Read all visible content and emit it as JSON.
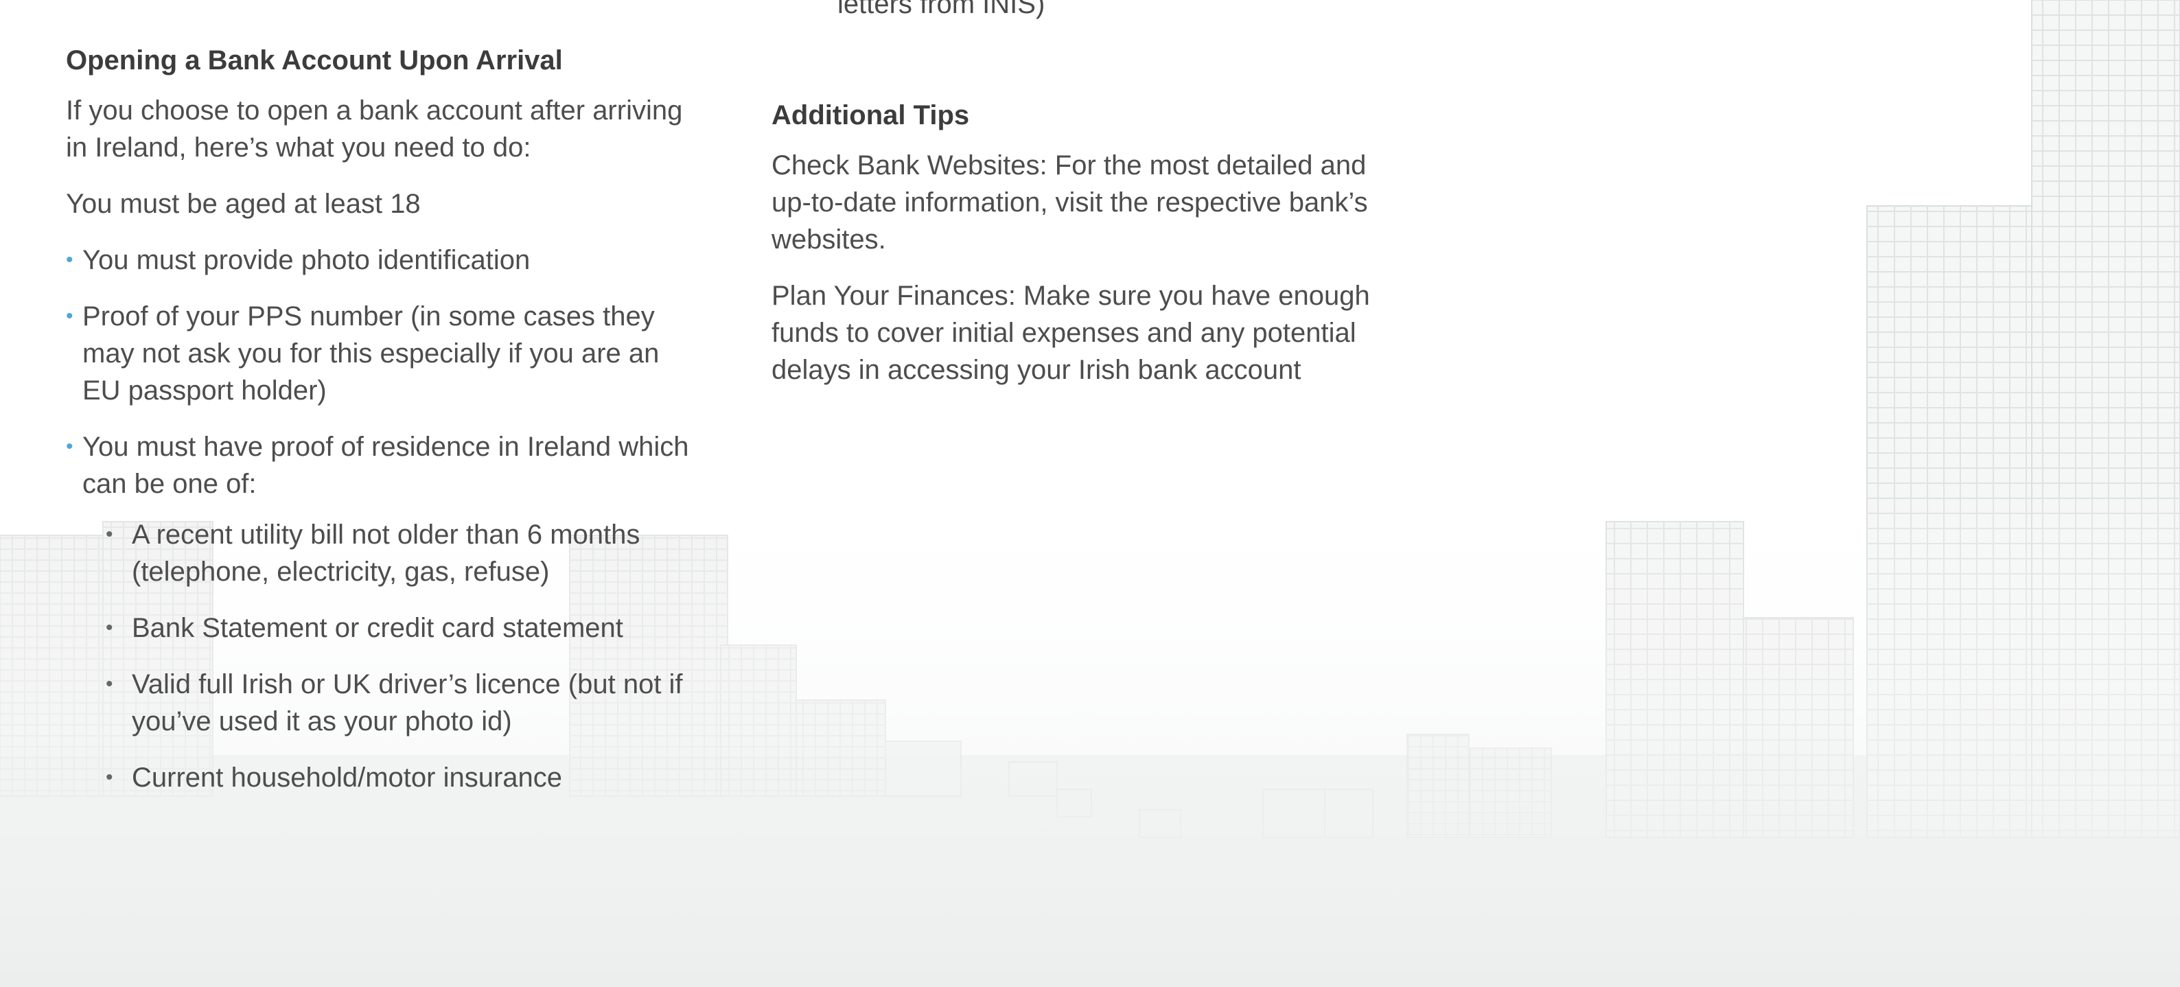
{
  "top_fragment": "letters from INIS)",
  "left_column": {
    "heading": "Opening a Bank Account Upon Arrival",
    "intro": "If you choose to open a bank account after arriving in Ireland, here’s what you need to do:",
    "age_requirement": "You must be aged at least 18",
    "requirements": [
      "You must provide photo identification",
      "Proof of your PPS number (in some cases they may not ask you for this especially if you are an EU passport holder)",
      "You must have proof of residence in Ireland which can be one of:"
    ],
    "residence_proofs": [
      "A recent utility bill not older than 6 months (telephone, electricity, gas, refuse)",
      "Bank Statement or credit card statement",
      "Valid full Irish or UK driver’s licence (but not if you’ve used it as your photo id)",
      "Current household/motor insurance"
    ]
  },
  "right_column": {
    "heading": "Additional Tips",
    "tips": [
      "Check Bank Websites: For the most detailed and up-to-date information, visit the respective bank’s websites.",
      "Plan Your Finances: Make sure you have enough funds to cover initial expenses and any potential delays in accessing your Irish bank account"
    ]
  },
  "colors": {
    "bullet_accent": "#4fa7d8",
    "body_text": "#4d4d4d",
    "skyline": "#d9dcdc"
  },
  "icons": {
    "background": "city-skyline-illustration"
  }
}
